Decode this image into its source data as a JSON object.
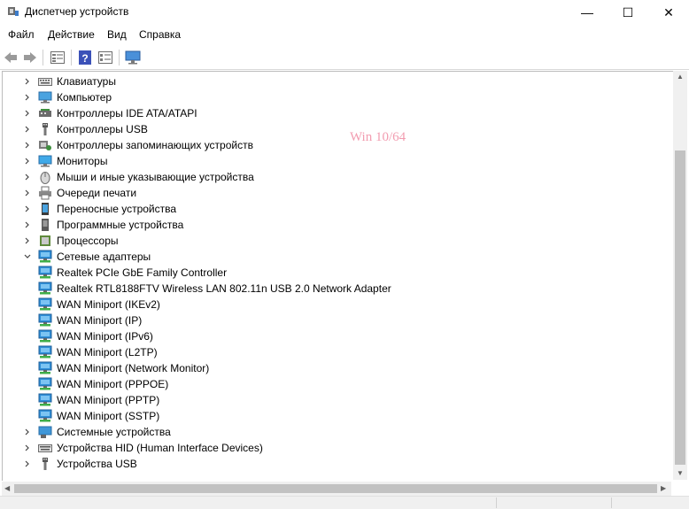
{
  "window": {
    "title": "Диспетчер устройств",
    "minimize": "—",
    "maximize": "☐",
    "close": "✕"
  },
  "menu": [
    "Файл",
    "Действие",
    "Вид",
    "Справка"
  ],
  "toolbar": [
    "back-icon",
    "forward-icon",
    "properties-icon",
    "help-icon",
    "view-icon",
    "monitor-icon"
  ],
  "watermark": "Win 10/64",
  "tree": [
    {
      "label": "Клавиатуры",
      "icon": "keyboard-icon",
      "level": 0,
      "expander": "collapsed"
    },
    {
      "label": "Компьютер",
      "icon": "computer-icon",
      "level": 0,
      "expander": "collapsed"
    },
    {
      "label": "Контроллеры IDE ATA/ATAPI",
      "icon": "ide-controller-icon",
      "level": 0,
      "expander": "collapsed"
    },
    {
      "label": "Контроллеры USB",
      "icon": "usb-icon",
      "level": 0,
      "expander": "collapsed"
    },
    {
      "label": "Контроллеры запоминающих устройств",
      "icon": "storage-controller-icon",
      "level": 0,
      "expander": "collapsed"
    },
    {
      "label": "Мониторы",
      "icon": "monitor-icon",
      "level": 0,
      "expander": "collapsed"
    },
    {
      "label": "Мыши и иные указывающие устройства",
      "icon": "mouse-icon",
      "level": 0,
      "expander": "collapsed"
    },
    {
      "label": "Очереди печати",
      "icon": "printer-icon",
      "level": 0,
      "expander": "collapsed"
    },
    {
      "label": "Переносные устройства",
      "icon": "portable-device-icon",
      "level": 0,
      "expander": "collapsed"
    },
    {
      "label": "Программные устройства",
      "icon": "software-device-icon",
      "level": 0,
      "expander": "collapsed"
    },
    {
      "label": "Процессоры",
      "icon": "processor-icon",
      "level": 0,
      "expander": "collapsed"
    },
    {
      "label": "Сетевые адаптеры",
      "icon": "network-adapter-icon",
      "level": 0,
      "expander": "expanded"
    },
    {
      "label": "Realtek PCIe GbE Family Controller",
      "icon": "network-adapter-icon",
      "level": 1,
      "expander": "none"
    },
    {
      "label": "Realtek RTL8188FTV Wireless LAN 802.11n USB 2.0 Network Adapter",
      "icon": "network-adapter-icon",
      "level": 1,
      "expander": "none"
    },
    {
      "label": "WAN Miniport (IKEv2)",
      "icon": "network-adapter-icon",
      "level": 1,
      "expander": "none"
    },
    {
      "label": "WAN Miniport (IP)",
      "icon": "network-adapter-icon",
      "level": 1,
      "expander": "none"
    },
    {
      "label": "WAN Miniport (IPv6)",
      "icon": "network-adapter-icon",
      "level": 1,
      "expander": "none"
    },
    {
      "label": "WAN Miniport (L2TP)",
      "icon": "network-adapter-icon",
      "level": 1,
      "expander": "none"
    },
    {
      "label": "WAN Miniport (Network Monitor)",
      "icon": "network-adapter-icon",
      "level": 1,
      "expander": "none"
    },
    {
      "label": "WAN Miniport (PPPOE)",
      "icon": "network-adapter-icon",
      "level": 1,
      "expander": "none"
    },
    {
      "label": "WAN Miniport (PPTP)",
      "icon": "network-adapter-icon",
      "level": 1,
      "expander": "none"
    },
    {
      "label": "WAN Miniport (SSTP)",
      "icon": "network-adapter-icon",
      "level": 1,
      "expander": "none"
    },
    {
      "label": "Системные устройства",
      "icon": "system-device-icon",
      "level": 0,
      "expander": "collapsed"
    },
    {
      "label": "Устройства HID (Human Interface Devices)",
      "icon": "hid-icon",
      "level": 0,
      "expander": "collapsed"
    },
    {
      "label": "Устройства USB",
      "icon": "usb-icon",
      "level": 0,
      "expander": "collapsed"
    }
  ]
}
